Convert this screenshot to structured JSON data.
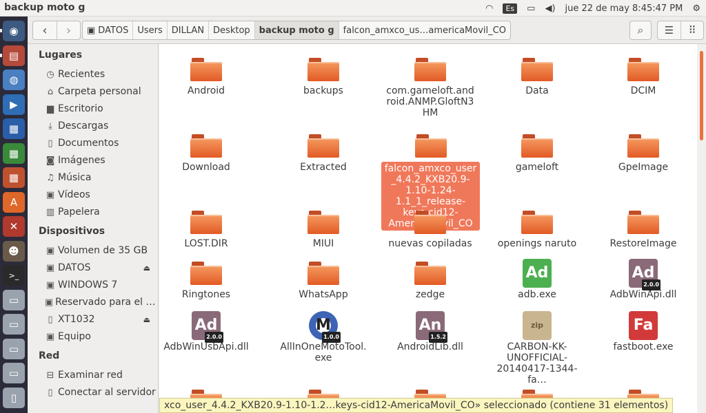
{
  "window_title": "backup moto g",
  "panel": {
    "keyboard": "Es",
    "clock": "jue 22 de may  8:45:47 PM"
  },
  "launcher": [
    {
      "icon": "ubuntu-dash-icon",
      "color": "#3d5a80"
    },
    {
      "icon": "files-icon",
      "color": "#b54a3a"
    },
    {
      "icon": "chromium-icon",
      "color": "#4a7fc1"
    },
    {
      "icon": "media-player-icon",
      "color": "#2f6db5"
    },
    {
      "icon": "writer-icon",
      "color": "#2b5ea8"
    },
    {
      "icon": "calc-icon",
      "color": "#3a8a3a"
    },
    {
      "icon": "impress-icon",
      "color": "#c0512f"
    },
    {
      "icon": "software-center-icon",
      "color": "#e0672a"
    },
    {
      "icon": "settings-icon",
      "color": "#b03a2e"
    },
    {
      "icon": "gimp-icon",
      "color": "#6a5a4a"
    },
    {
      "icon": "terminal-icon",
      "color": "#2a2a2a"
    },
    {
      "icon": "drive-icon",
      "color": "#9aa3ad"
    },
    {
      "icon": "drive-icon",
      "color": "#9aa3ad"
    },
    {
      "icon": "drive-icon",
      "color": "#9aa3ad"
    },
    {
      "icon": "drive-icon",
      "color": "#9aa3ad"
    },
    {
      "icon": "usb-drive-icon",
      "color": "#9aa3ad"
    }
  ],
  "breadcrumbs": [
    "DATOS",
    "Users",
    "DILLAN",
    "Desktop",
    "backup moto g",
    "falcon_amxco_us…americaMovil_CO"
  ],
  "sidebar": {
    "places_title": "Lugares",
    "places": [
      {
        "label": "Recientes",
        "icon": "clock-icon",
        "glyph": "◷"
      },
      {
        "label": "Carpeta personal",
        "icon": "home-icon",
        "glyph": "⌂"
      },
      {
        "label": "Escritorio",
        "icon": "desktop-icon",
        "glyph": "▆"
      },
      {
        "label": "Descargas",
        "icon": "download-icon",
        "glyph": "⤓"
      },
      {
        "label": "Documentos",
        "icon": "document-icon",
        "glyph": "▯"
      },
      {
        "label": "Imágenes",
        "icon": "camera-icon",
        "glyph": "◙"
      },
      {
        "label": "Música",
        "icon": "music-icon",
        "glyph": "♫"
      },
      {
        "label": "Vídeos",
        "icon": "video-icon",
        "glyph": "▣"
      },
      {
        "label": "Papelera",
        "icon": "trash-icon",
        "glyph": "▥"
      }
    ],
    "devices_title": "Dispositivos",
    "devices": [
      {
        "label": "Volumen de 35 GB",
        "icon": "drive-icon",
        "glyph": "▣",
        "eject": false
      },
      {
        "label": "DATOS",
        "icon": "drive-icon",
        "glyph": "▣",
        "eject": true
      },
      {
        "label": "WINDOWS 7",
        "icon": "drive-icon",
        "glyph": "▣",
        "eject": false
      },
      {
        "label": "Reservado para el sistema",
        "icon": "drive-icon",
        "glyph": "▣",
        "eject": false
      },
      {
        "label": "XT1032",
        "icon": "phone-icon",
        "glyph": "▯",
        "eject": true
      },
      {
        "label": "Equipo",
        "icon": "computer-icon",
        "glyph": "▣",
        "eject": false
      }
    ],
    "network_title": "Red",
    "network": [
      {
        "label": "Examinar red",
        "icon": "network-icon",
        "glyph": "⊟"
      },
      {
        "label": "Conectar al servidor",
        "icon": "server-icon",
        "glyph": "▯"
      }
    ]
  },
  "files": [
    {
      "name": "Android",
      "kind": "folder"
    },
    {
      "name": "backups",
      "kind": "folder"
    },
    {
      "name": "com.gameloft.android.ANMP.GloftN3HM",
      "kind": "folder"
    },
    {
      "name": "Data",
      "kind": "folder"
    },
    {
      "name": "DCIM",
      "kind": "folder"
    },
    {
      "name": "Download",
      "kind": "folder"
    },
    {
      "name": "Extracted",
      "kind": "folder"
    },
    {
      "name": "falcon_amxco_user_4.4.2_KXB20.9-1.10-1.24-1.1_1_release-keys-cid12-AmericaMovil_CO",
      "kind": "folder",
      "selected": true
    },
    {
      "name": "gameloft",
      "kind": "folder"
    },
    {
      "name": "GpeImage",
      "kind": "folder"
    },
    {
      "name": "LOST.DIR",
      "kind": "folder"
    },
    {
      "name": "MIUI",
      "kind": "folder"
    },
    {
      "name": "nuevas copiladas",
      "kind": "folder"
    },
    {
      "name": "openings naruto",
      "kind": "folder"
    },
    {
      "name": "RestoreImage",
      "kind": "folder"
    },
    {
      "name": "Ringtones",
      "kind": "folder"
    },
    {
      "name": "WhatsApp",
      "kind": "folder"
    },
    {
      "name": "zedge",
      "kind": "folder"
    },
    {
      "name": "adb.exe",
      "kind": "app",
      "glyph": "Ad",
      "color": "#4caf50",
      "icon": "adb-icon"
    },
    {
      "name": "AdbWinApi.dll",
      "kind": "app",
      "glyph": "Ad",
      "color": "#8a6a78",
      "icon": "dll-icon",
      "version": "2.0.0"
    },
    {
      "name": "AdbWinUsbApi.dll",
      "kind": "app",
      "glyph": "Ad",
      "color": "#8a6a78",
      "icon": "dll-icon",
      "version": "2.0.0"
    },
    {
      "name": "AllInOneMotoTool.exe",
      "kind": "app",
      "glyph": "M",
      "color": "#3d64b5",
      "icon": "motorola-icon",
      "version": "1.0.0"
    },
    {
      "name": "AndroidLib.dll",
      "kind": "app",
      "glyph": "An",
      "color": "#8a6a78",
      "icon": "dll-icon",
      "version": "1.5.2"
    },
    {
      "name": "CARBON-KK-UNOFFICIAL-20140417-1344-fa…",
      "kind": "app",
      "glyph": "zip",
      "color": "#c9b58f",
      "icon": "zip-icon"
    },
    {
      "name": "fastboot.exe",
      "kind": "app",
      "glyph": "Fa",
      "color": "#d23a3a",
      "icon": "fastboot-icon"
    }
  ],
  "status_text": "xco_user_4.4.2_KXB20.9-1.10-1.2…keys-cid12-AmericaMovil_CO» seleccionado  (contiene 31 elementos)"
}
